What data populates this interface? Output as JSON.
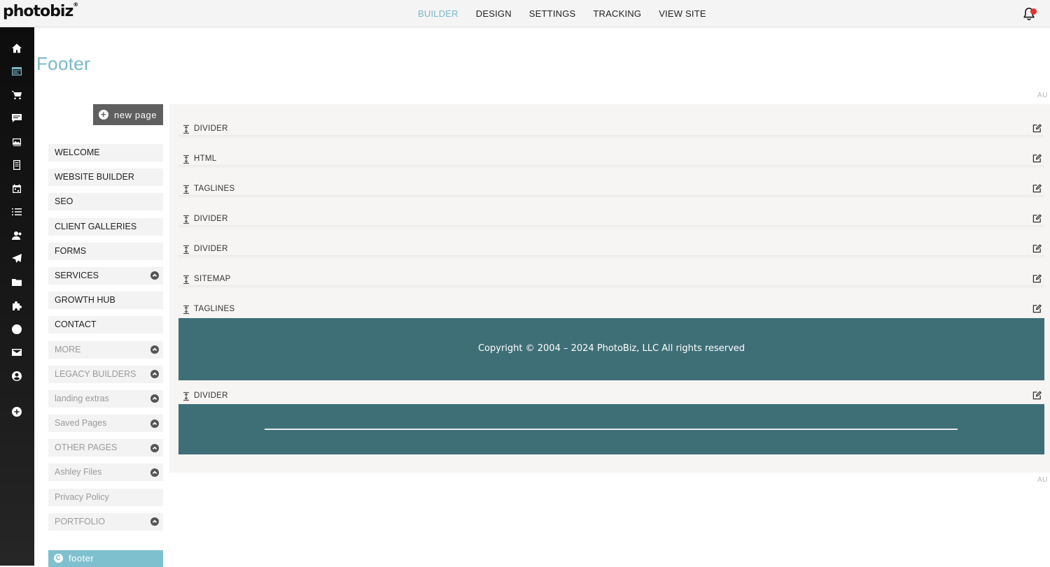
{
  "brand": {
    "name": "photobiz",
    "mark": "®"
  },
  "topnav": {
    "items": [
      "BUILDER",
      "DESIGN",
      "SETTINGS",
      "TRACKING",
      "VIEW SITE"
    ],
    "active": "BUILDER"
  },
  "notifications": {
    "icon": "bell-icon",
    "has_alert": true,
    "alert_color": "#e63030"
  },
  "rail": {
    "icons": [
      "home-icon",
      "website-icon",
      "cart-icon",
      "chat-icon",
      "gallery-icon",
      "document-icon",
      "calendar-icon",
      "list-icon",
      "contacts-icon",
      "send-icon",
      "folder-icon",
      "puzzle-icon",
      "globe-icon",
      "mail-icon",
      "account-icon",
      "add-icon"
    ],
    "active": "website-icon"
  },
  "page": {
    "title": "Footer"
  },
  "new_page_button": {
    "label": "new page"
  },
  "pages": [
    {
      "label": "WELCOME",
      "muted": false,
      "expandable": false
    },
    {
      "label": "WEBSITE BUILDER",
      "muted": false,
      "expandable": false
    },
    {
      "label": "SEO",
      "muted": false,
      "expandable": false
    },
    {
      "label": "CLIENT GALLERIES",
      "muted": false,
      "expandable": false
    },
    {
      "label": "FORMS",
      "muted": false,
      "expandable": false
    },
    {
      "label": "SERVICES",
      "muted": false,
      "expandable": true
    },
    {
      "label": "GROWTH HUB",
      "muted": false,
      "expandable": false
    },
    {
      "label": "CONTACT",
      "muted": false,
      "expandable": false
    },
    {
      "label": "MORE",
      "muted": true,
      "expandable": true
    },
    {
      "label": "LEGACY BUILDERS",
      "muted": true,
      "expandable": true
    },
    {
      "label": "landing extras",
      "muted": true,
      "expandable": true
    },
    {
      "label": "Saved Pages",
      "muted": true,
      "expandable": true
    },
    {
      "label": "OTHER PAGES",
      "muted": true,
      "expandable": true
    },
    {
      "label": "Ashley Files",
      "muted": true,
      "expandable": true
    },
    {
      "label": "Privacy Policy",
      "muted": true,
      "expandable": false
    },
    {
      "label": "PORTFOLIO",
      "muted": true,
      "expandable": true
    }
  ],
  "current_footer_item": {
    "label": "footer"
  },
  "builder": {
    "auto_label": "AU",
    "blocks": [
      {
        "label": "DIVIDER"
      },
      {
        "label": "HTML"
      },
      {
        "label": "TAGLINES"
      },
      {
        "label": "DIVIDER"
      },
      {
        "label": "DIVIDER"
      },
      {
        "label": "SITEMAP"
      },
      {
        "label": "TAGLINES"
      },
      {
        "label": "DIVIDER"
      }
    ],
    "copyright_text": "Copyright © 2004 – 2024 PhotoBiz, LLC All rights reserved",
    "block_color": "#3e6f76",
    "accent_color": "#7ab8c9"
  }
}
